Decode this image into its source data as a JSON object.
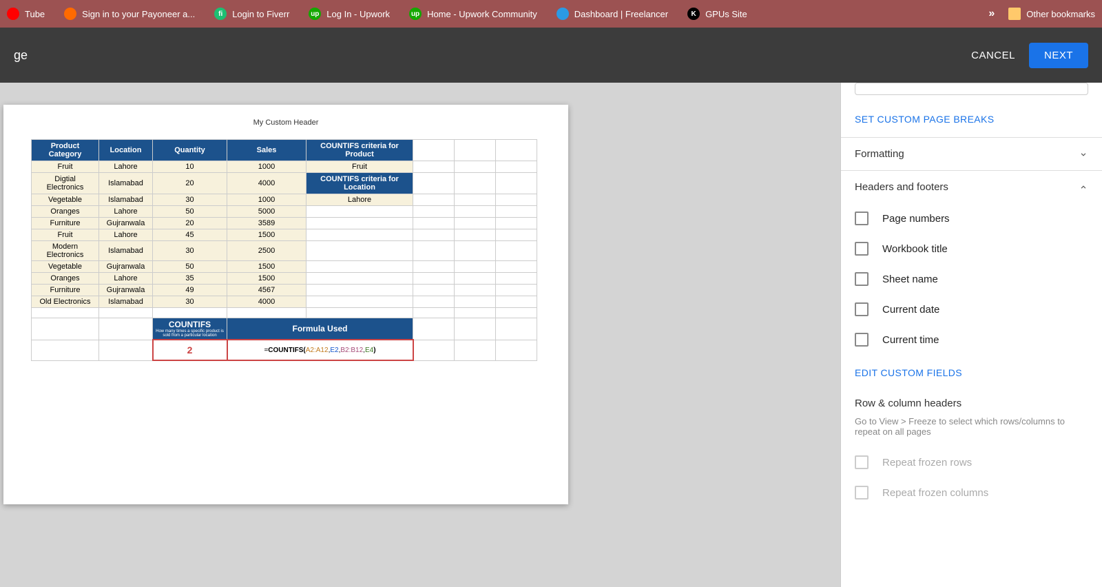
{
  "bookmarks": [
    {
      "label": "Tube",
      "icon": "",
      "bg": "#ff0000"
    },
    {
      "label": "Sign in to your Payoneer a...",
      "icon": "",
      "bg": "#ff6a00"
    },
    {
      "label": "Login to Fiverr",
      "icon": "fi",
      "bg": "#1dbf73"
    },
    {
      "label": "Log In - Upwork",
      "icon": "up",
      "bg": "#14a800"
    },
    {
      "label": "Home - Upwork Community",
      "icon": "up",
      "bg": "#14a800"
    },
    {
      "label": "Dashboard | Freelancer",
      "icon": "",
      "bg": "#2a9ae5"
    },
    {
      "label": "GPUs Site",
      "icon": "K",
      "bg": "#000000"
    }
  ],
  "overflow": "»",
  "other_bookmarks": "Other bookmarks",
  "header": {
    "left": "ge",
    "cancel": "CANCEL",
    "next": "NEXT"
  },
  "page": {
    "custom_header": "My Custom Header",
    "columns": [
      "Product Category",
      "Location",
      "Quantity",
      "Sales",
      "COUNTIFS criteria for Product"
    ],
    "criteria_product": "Fruit",
    "criteria_location_label": "COUNTIFS criteria for Location",
    "criteria_location": "Lahore",
    "rows": [
      {
        "cat": "Fruit",
        "loc": "Lahore",
        "qty": "10",
        "sales": "1000"
      },
      {
        "cat": "Digtial Electronics",
        "loc": "Islamabad",
        "qty": "20",
        "sales": "4000"
      },
      {
        "cat": "Vegetable",
        "loc": "Islamabad",
        "qty": "30",
        "sales": "1000"
      },
      {
        "cat": "Oranges",
        "loc": "Lahore",
        "qty": "50",
        "sales": "5000"
      },
      {
        "cat": "Furniture",
        "loc": "Gujranwala",
        "qty": "20",
        "sales": "3589"
      },
      {
        "cat": "Fruit",
        "loc": "Lahore",
        "qty": "45",
        "sales": "1500"
      },
      {
        "cat": "Modern Electronics",
        "loc": "Islamabad",
        "qty": "30",
        "sales": "2500"
      },
      {
        "cat": "Vegetable",
        "loc": "Gujranwala",
        "qty": "50",
        "sales": "1500"
      },
      {
        "cat": "Oranges",
        "loc": "Lahore",
        "qty": "35",
        "sales": "1500"
      },
      {
        "cat": "Furniture",
        "loc": "Gujranwala",
        "qty": "49",
        "sales": "4567"
      },
      {
        "cat": "Old Electronics",
        "loc": "Islamabad",
        "qty": "30",
        "sales": "4000"
      }
    ],
    "countifs_title": "COUNTIFS",
    "countifs_sub": "How many times a specific product is sold from a particular location",
    "formula_used_label": "Formula Used",
    "result": "2",
    "formula_eq": "=",
    "formula_fn": "COUNTIFS(",
    "formula_r1": "A2:A12",
    "formula_ref1": "E2",
    "formula_r2": "B2:B12",
    "formula_ref2": "E4",
    "formula_close": ")"
  },
  "sidebar": {
    "page_breaks": "SET CUSTOM PAGE BREAKS",
    "formatting": "Formatting",
    "headers_footers": "Headers and footers",
    "options": [
      "Page numbers",
      "Workbook title",
      "Sheet name",
      "Current date",
      "Current time"
    ],
    "edit_custom": "EDIT CUSTOM FIELDS",
    "row_col_headers": "Row & column headers",
    "help": "Go to View > Freeze to select which rows/columns to repeat on all pages",
    "repeat_rows": "Repeat frozen rows",
    "repeat_cols": "Repeat frozen columns"
  }
}
